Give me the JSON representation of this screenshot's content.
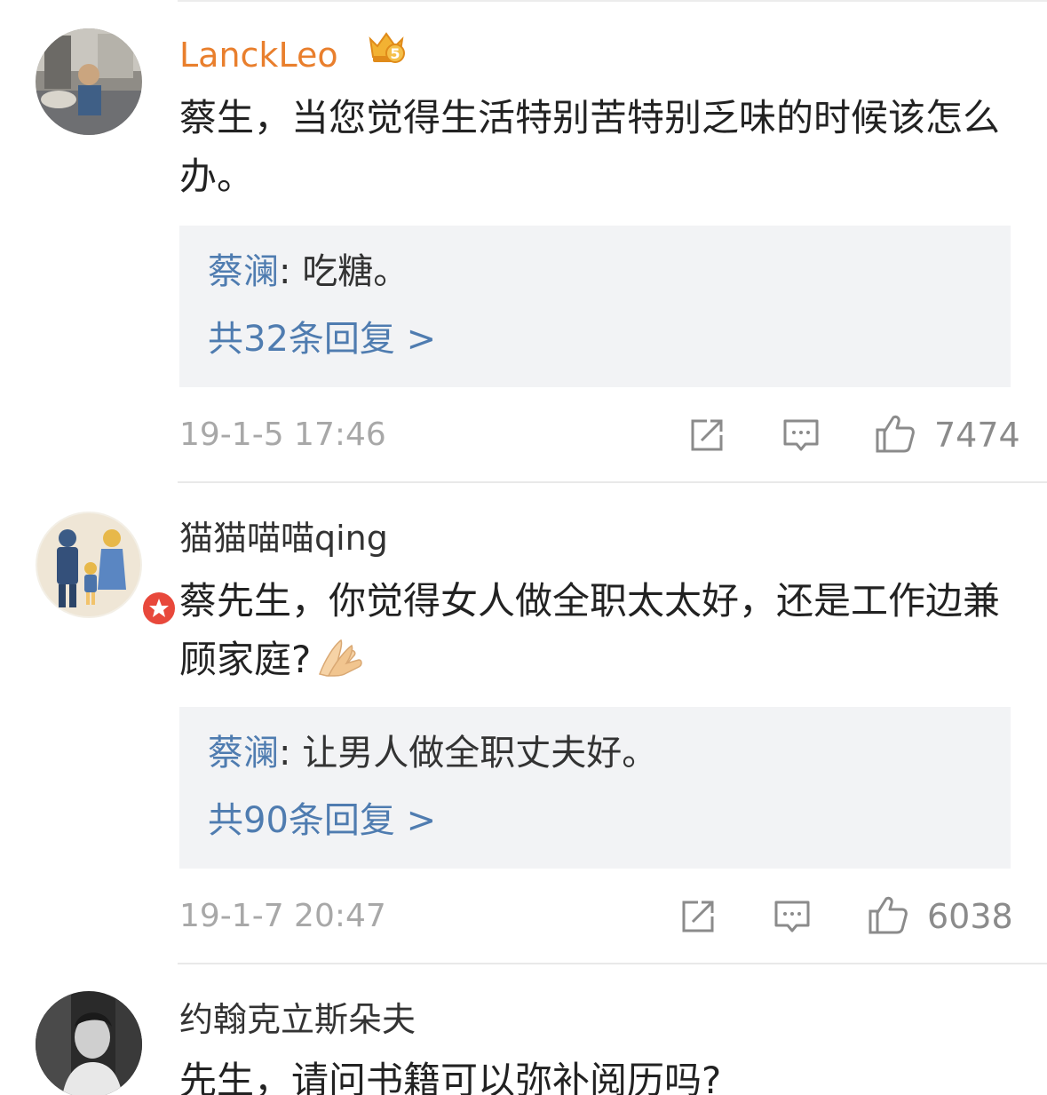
{
  "comments": [
    {
      "username": "LanckLeo",
      "vip_level": "5",
      "text": "蔡生，当您觉得生活特别苦特别乏味的时候该怎么办。",
      "reply": {
        "author": "蔡澜",
        "separator": ": ",
        "text": "吃糖。",
        "count_label": "共32条回复 >"
      },
      "time": "19-1-5 17:46",
      "likes": "7474"
    },
    {
      "username": "猫猫喵喵qing",
      "text": "蔡先生，你觉得女人做全职太太好，还是工作边兼顾家庭?",
      "reply": {
        "author": "蔡澜",
        "separator": ": ",
        "text": "让男人做全职丈夫好。",
        "count_label": "共90条回复 >"
      },
      "time": "19-1-7 20:47",
      "likes": "6038"
    },
    {
      "username": "约翰克立斯朵夫",
      "text": "先生，请问书籍可以弥补阅历吗?"
    }
  ],
  "icons": {
    "share": "share-icon",
    "comment": "comment-icon",
    "like": "thumbs-up-icon",
    "vip": "crown-vip-icon",
    "verified": "verified-badge-icon",
    "emoji": "pray-hands-emoji"
  },
  "colors": {
    "vip_name": "#e97f2d",
    "reply_link": "#4f7cb0",
    "reply_bg": "#f2f3f5",
    "meta": "#a8a8a8"
  }
}
